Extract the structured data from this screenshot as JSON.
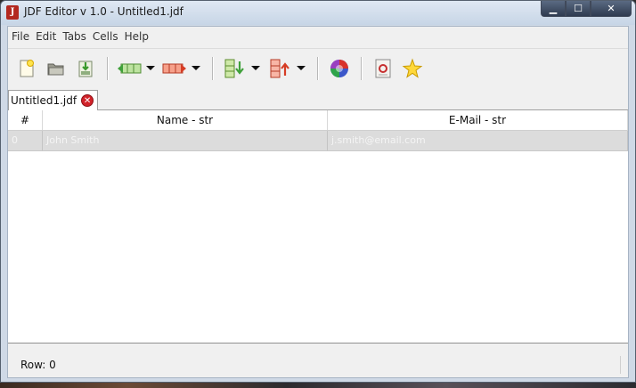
{
  "window": {
    "title": "JDF Editor v 1.0 - Untitled1.jdf",
    "app_icon": "jdf-app-icon",
    "buttons": {
      "minimize": "▁",
      "maximize": "☐",
      "close": "✕"
    }
  },
  "menu": {
    "items": [
      "File",
      "Edit",
      "Tabs",
      "Cells",
      "Help"
    ]
  },
  "toolbar": {
    "buttons": [
      "new-file-icon",
      "open-folder-icon",
      "save-icon",
      "insert-row-left-icon",
      "insert-row-right-icon",
      "insert-column-down-icon",
      "insert-column-up-icon",
      "refresh-icon",
      "document-settings-icon",
      "star-icon"
    ]
  },
  "tabs": [
    {
      "label": "Untitled1.jdf",
      "active": true
    }
  ],
  "table": {
    "columns": [
      "#",
      "Name - str",
      "E-Mail - str"
    ],
    "rows": [
      {
        "index": "0",
        "name": "John Smith",
        "email": "j.smith@email.com"
      }
    ]
  },
  "status": {
    "text": "Row: 0"
  },
  "colors": {
    "titlebar": "#c7d5e6",
    "selected_row": "#dcdcdc",
    "close_tab": "#d2232a"
  }
}
